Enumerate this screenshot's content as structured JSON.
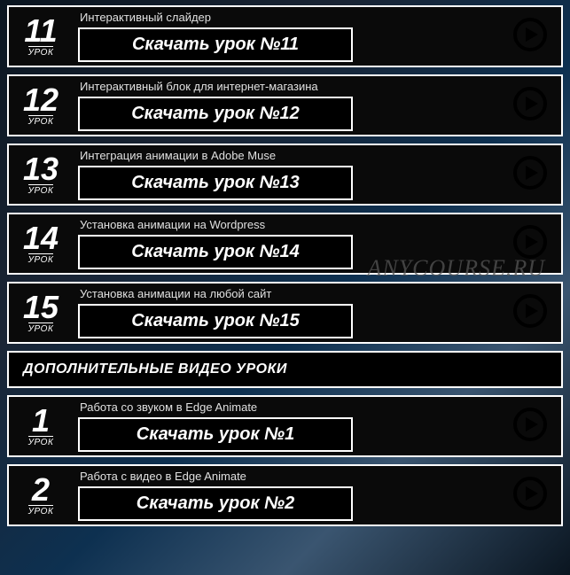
{
  "lesson_word": "УРОК",
  "watermark": "ANYCOURSE.RU",
  "section_header": "ДОПОЛНИТЕЛЬНЫЕ ВИДЕО УРОКИ",
  "lessons_main": [
    {
      "num": "11",
      "title": "Интерактивный слайдер",
      "button": "Скачать урок №11"
    },
    {
      "num": "12",
      "title": "Интерактивный блок для интернет-магазина",
      "button": "Скачать урок №12"
    },
    {
      "num": "13",
      "title": "Интеграция анимации в Adobe Muse",
      "button": "Скачать урок №13"
    },
    {
      "num": "14",
      "title": "Установка анимации на Wordpress",
      "button": "Скачать урок №14"
    },
    {
      "num": "15",
      "title": "Установка анимации на любой сайт",
      "button": "Скачать урок №15"
    }
  ],
  "lessons_extra": [
    {
      "num": "1",
      "title": "Работа со звуком в Edge Animate",
      "button": "Скачать урок №1"
    },
    {
      "num": "2",
      "title": "Работа с видео в Edge Animate",
      "button": "Скачать урок №2"
    }
  ]
}
